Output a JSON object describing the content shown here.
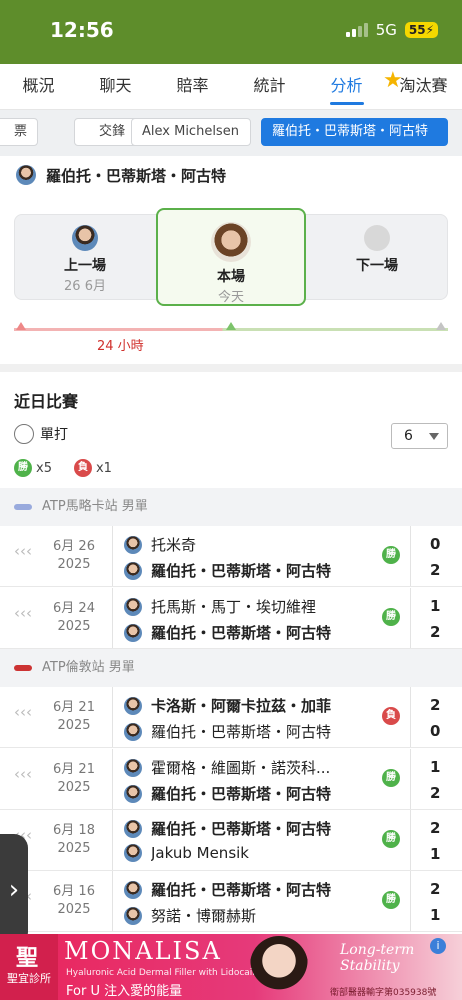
{
  "status_bar": {
    "time": "12:56",
    "network": "5G",
    "battery": "55"
  },
  "tabs": [
    "概況",
    "聊天",
    "賠率",
    "統計",
    "分析",
    "淘汰賽"
  ],
  "active_tab": 4,
  "chips": [
    "票",
    "交鋒",
    "Alex Michelsen",
    "羅伯托・巴蒂斯塔・阿古特"
  ],
  "player": {
    "name": "羅伯托・巴蒂斯塔・阿古特"
  },
  "match_nav": {
    "previous": {
      "label": "上一場",
      "date": "26 6月"
    },
    "current": {
      "label": "本場",
      "date": "今天"
    },
    "next": {
      "label": "下一場"
    }
  },
  "timeline": {
    "hours_label": "24 小時"
  },
  "recent": {
    "title": "近日比賽",
    "filter_label": "單打",
    "count_select": "6",
    "wins_badge": "勝",
    "wins": "x5",
    "losses_badge": "負",
    "losses": "x1"
  },
  "leagues": [
    {
      "name": "ATP馬略卡站 男單",
      "matches": [
        {
          "date": "6月 26",
          "year": "2025",
          "p1": "托米奇",
          "p2": "羅伯托・巴蒂斯塔・阿古特",
          "bold": 2,
          "result": "勝",
          "s1": "0",
          "s2": "2"
        },
        {
          "date": "6月 24",
          "year": "2025",
          "p1": "托馬斯・馬丁・埃切維裡",
          "p2": "羅伯托・巴蒂斯塔・阿古特",
          "bold": 2,
          "result": "勝",
          "s1": "1",
          "s2": "2"
        }
      ]
    },
    {
      "name": "ATP倫敦站 男單",
      "matches": [
        {
          "date": "6月 21",
          "year": "2025",
          "p1": "卡洛斯・阿爾卡拉茲・加菲",
          "p2": "羅伯托・巴蒂斯塔・阿古特",
          "bold": 1,
          "result": "負",
          "s1": "2",
          "s2": "0"
        },
        {
          "date": "6月 21",
          "year": "2025",
          "p1": "霍爾格・維圖斯・諾茨科...",
          "p2": "羅伯托・巴蒂斯塔・阿古特",
          "bold": 2,
          "result": "勝",
          "s1": "1",
          "s2": "2"
        },
        {
          "date": "6月 18",
          "year": "2025",
          "p1": "羅伯托・巴蒂斯塔・阿古特",
          "p2": "Jakub Mensik",
          "bold": 1,
          "result": "勝",
          "s1": "2",
          "s2": "1"
        },
        {
          "date": "6月 16",
          "year": "2025",
          "p1": "羅伯托・巴蒂斯塔・阿古特",
          "p2": "努諾・博爾赫斯",
          "bold": 1,
          "result": "勝",
          "s1": "2",
          "s2": "1"
        }
      ]
    }
  ],
  "ad": {
    "clinic": "聖宜診所",
    "brand": "MONALISA",
    "tagline": "Hyaluronic Acid Dermal Filler with Lidocaine",
    "slogan": "For U 注入愛的能量",
    "script": "Long-term Stability",
    "footer": "衛部醫器輸字第035938號"
  }
}
